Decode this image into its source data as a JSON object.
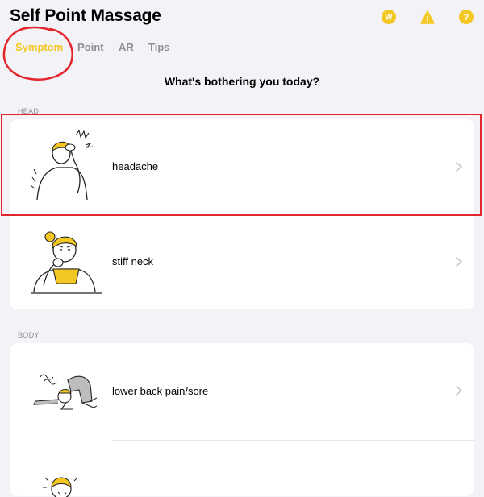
{
  "header": {
    "title": "Self Point Massage",
    "icons": [
      {
        "name": "w-coin-icon",
        "glyph": "W",
        "color": "#f3c724"
      },
      {
        "name": "warning-icon",
        "glyph": "!",
        "color": "#f3c724"
      },
      {
        "name": "help-icon",
        "glyph": "?",
        "color": "#f3c724"
      }
    ]
  },
  "tabs": [
    {
      "label": "Symptom",
      "active": true
    },
    {
      "label": "Point",
      "active": false
    },
    {
      "label": "AR",
      "active": false
    },
    {
      "label": "Tips",
      "active": false
    }
  ],
  "prompt": "What's bothering you today?",
  "sections": {
    "head": {
      "label": "HEAD",
      "items": [
        {
          "label": "headache",
          "illustration": "person-holding-head-illustration"
        },
        {
          "label": "stiff neck",
          "illustration": "person-resting-chin-illustration"
        }
      ]
    },
    "body": {
      "label": "BODY",
      "items": [
        {
          "label": "lower back pain/sore",
          "illustration": "person-collapsed-illustration"
        },
        {
          "label": "",
          "illustration": "person-sweating-illustration"
        }
      ]
    }
  },
  "colors": {
    "accent": "#f3c724",
    "background": "#f2f2f7",
    "annotation": "#e3262d"
  }
}
